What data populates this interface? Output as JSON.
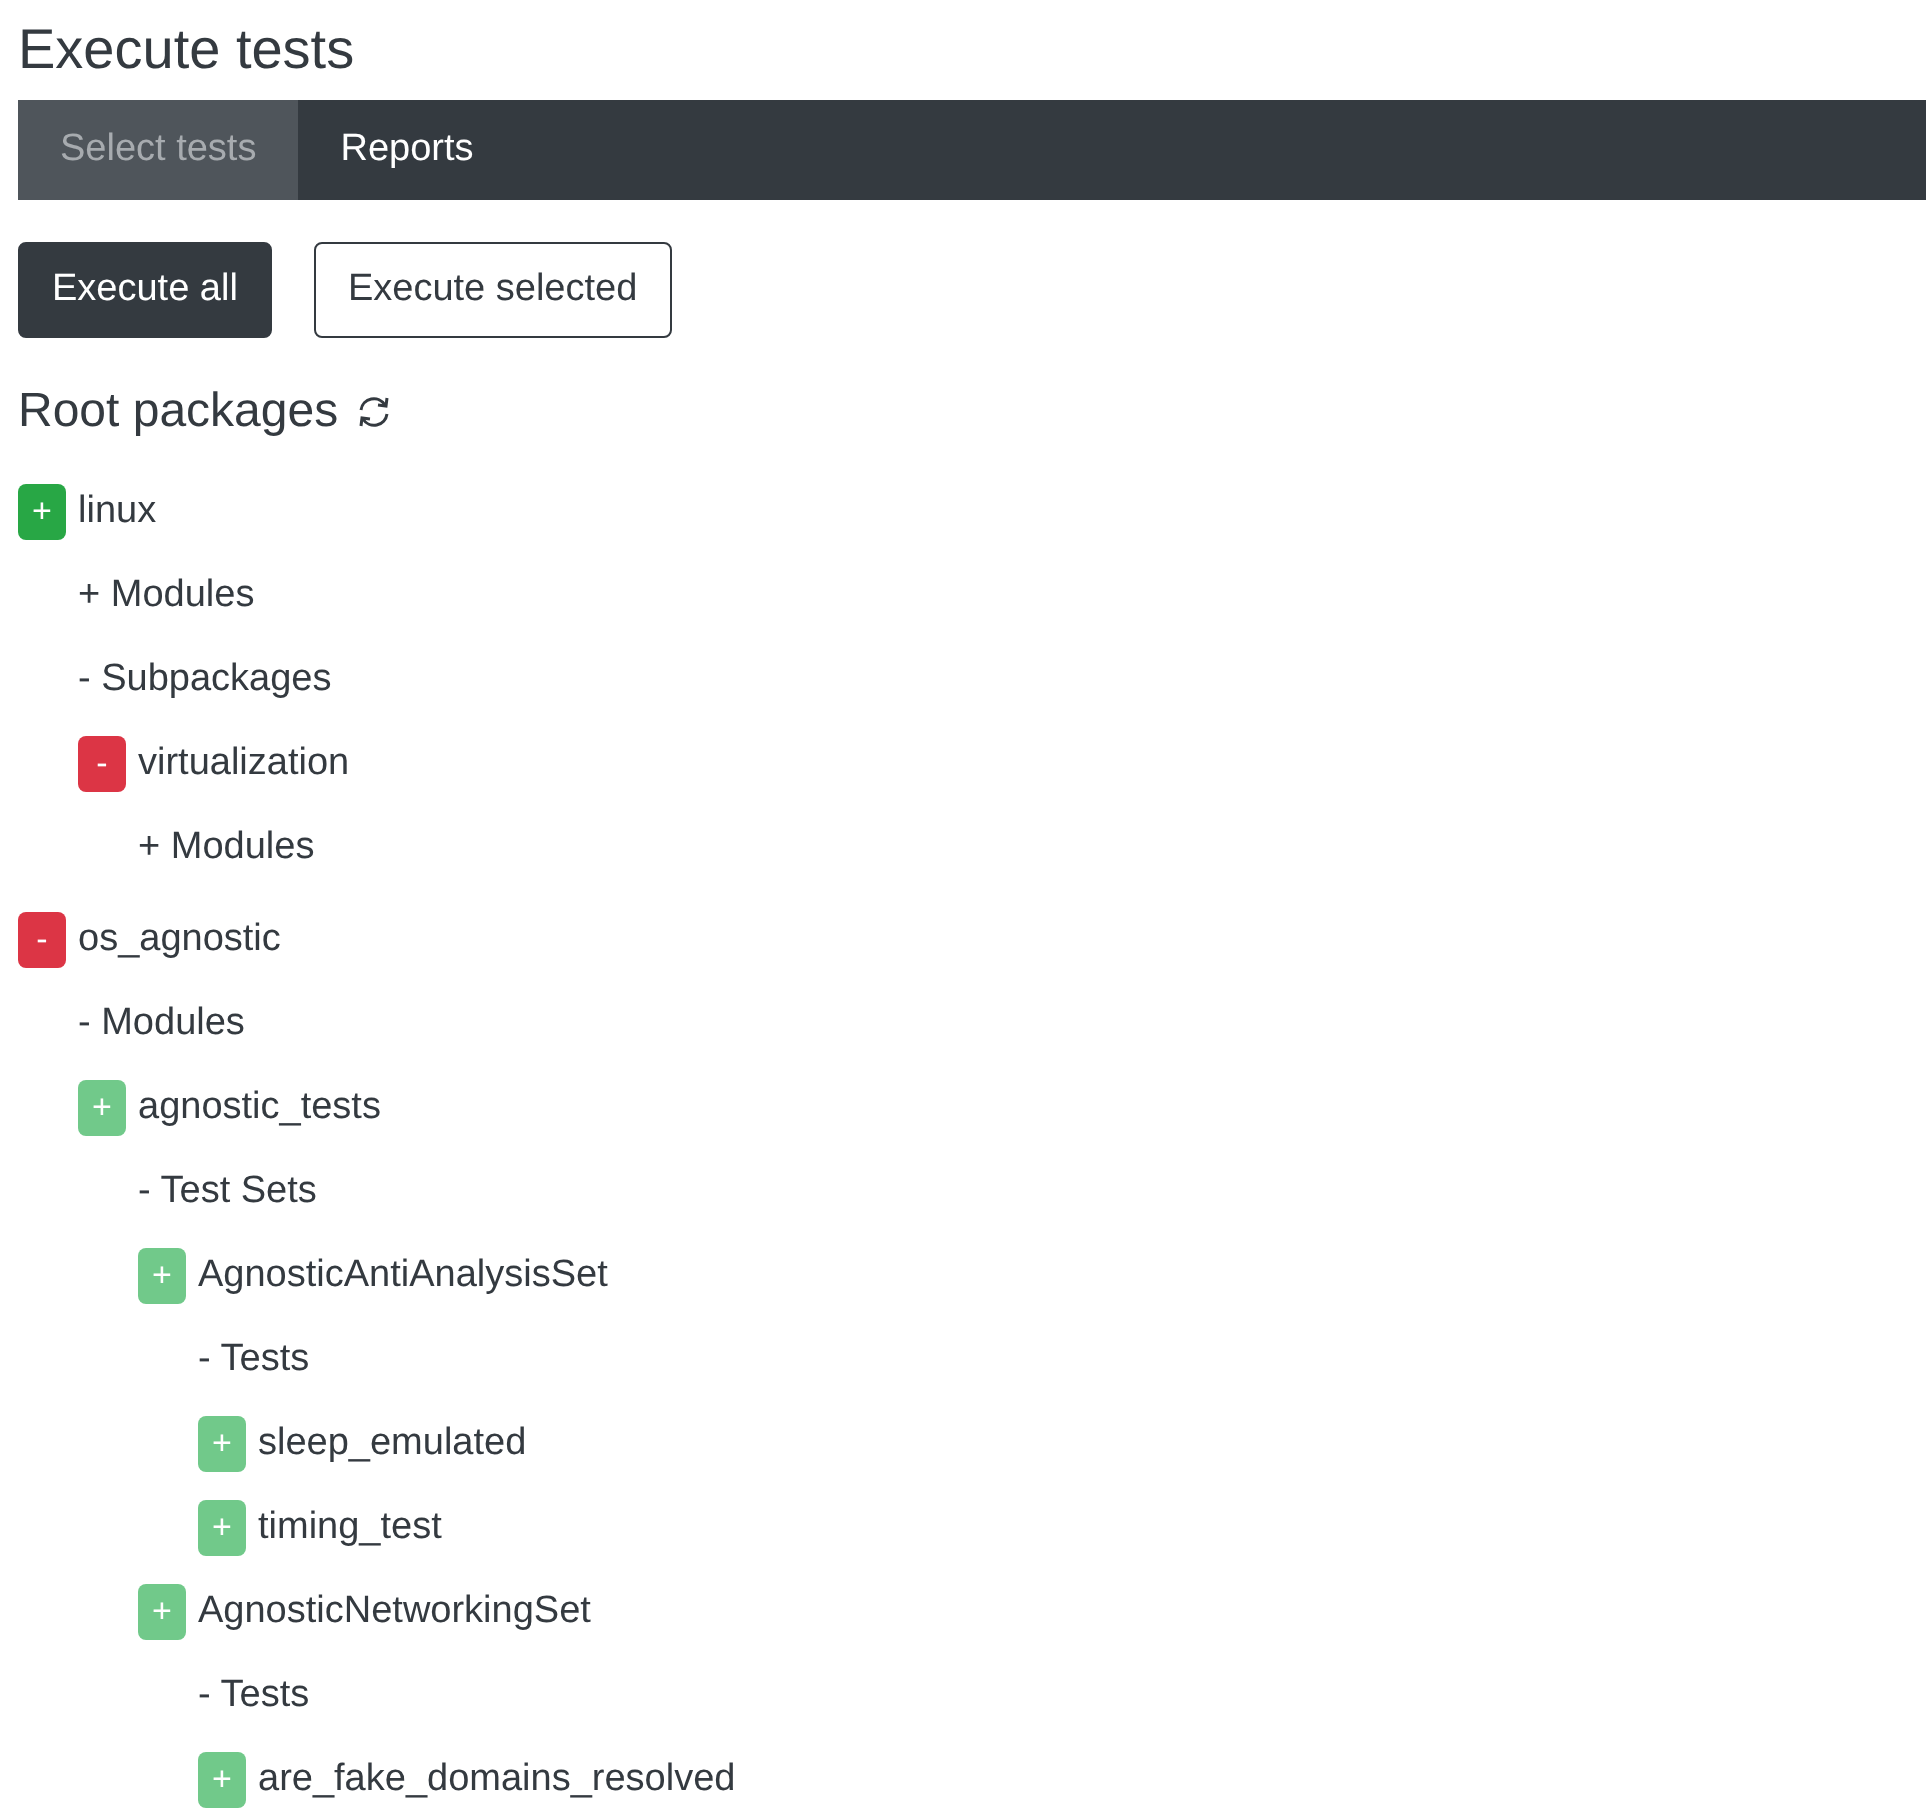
{
  "page_title": "Execute tests",
  "tabs": [
    {
      "label": "Select tests",
      "selected": true
    },
    {
      "label": "Reports",
      "selected": false
    }
  ],
  "buttons": [
    {
      "label": "Execute all",
      "kind": "primary"
    },
    {
      "label": "Execute selected",
      "kind": "outline"
    }
  ],
  "section_title": "Root packages",
  "tree": [
    {
      "kind": "item",
      "badge": "+",
      "selected": true,
      "disabled": false,
      "label": "linux",
      "children": [
        {
          "kind": "group",
          "label": "+ Modules"
        },
        {
          "kind": "group",
          "label": "- Subpackages",
          "children": [
            {
              "kind": "item",
              "badge": "-",
              "selected": false,
              "disabled": false,
              "label": "virtualization",
              "children": [
                {
                  "kind": "group",
                  "label": "+ Modules"
                }
              ]
            }
          ]
        }
      ]
    },
    {
      "kind": "item",
      "badge": "-",
      "selected": false,
      "disabled": false,
      "label": "os_agnostic",
      "children": [
        {
          "kind": "group",
          "label": "- Modules",
          "children": [
            {
              "kind": "item",
              "badge": "+",
              "selected": true,
              "disabled": true,
              "label": "agnostic_tests",
              "children": [
                {
                  "kind": "group",
                  "label": "- Test Sets",
                  "children": [
                    {
                      "kind": "item",
                      "badge": "+",
                      "selected": true,
                      "disabled": true,
                      "label": "AgnosticAntiAnalysisSet",
                      "children": [
                        {
                          "kind": "group",
                          "label": "- Tests",
                          "children": [
                            {
                              "kind": "item",
                              "badge": "+",
                              "selected": true,
                              "disabled": true,
                              "label": "sleep_emulated"
                            },
                            {
                              "kind": "item",
                              "badge": "+",
                              "selected": true,
                              "disabled": true,
                              "label": "timing_test"
                            }
                          ]
                        }
                      ]
                    },
                    {
                      "kind": "item",
                      "badge": "+",
                      "selected": true,
                      "disabled": true,
                      "label": "AgnosticNetworkingSet",
                      "children": [
                        {
                          "kind": "group",
                          "label": "- Tests",
                          "children": [
                            {
                              "kind": "item",
                              "badge": "+",
                              "selected": true,
                              "disabled": true,
                              "label": "are_fake_domains_resolved"
                            }
                          ]
                        }
                      ]
                    }
                  ]
                }
              ]
            }
          ]
        }
      ]
    }
  ]
}
